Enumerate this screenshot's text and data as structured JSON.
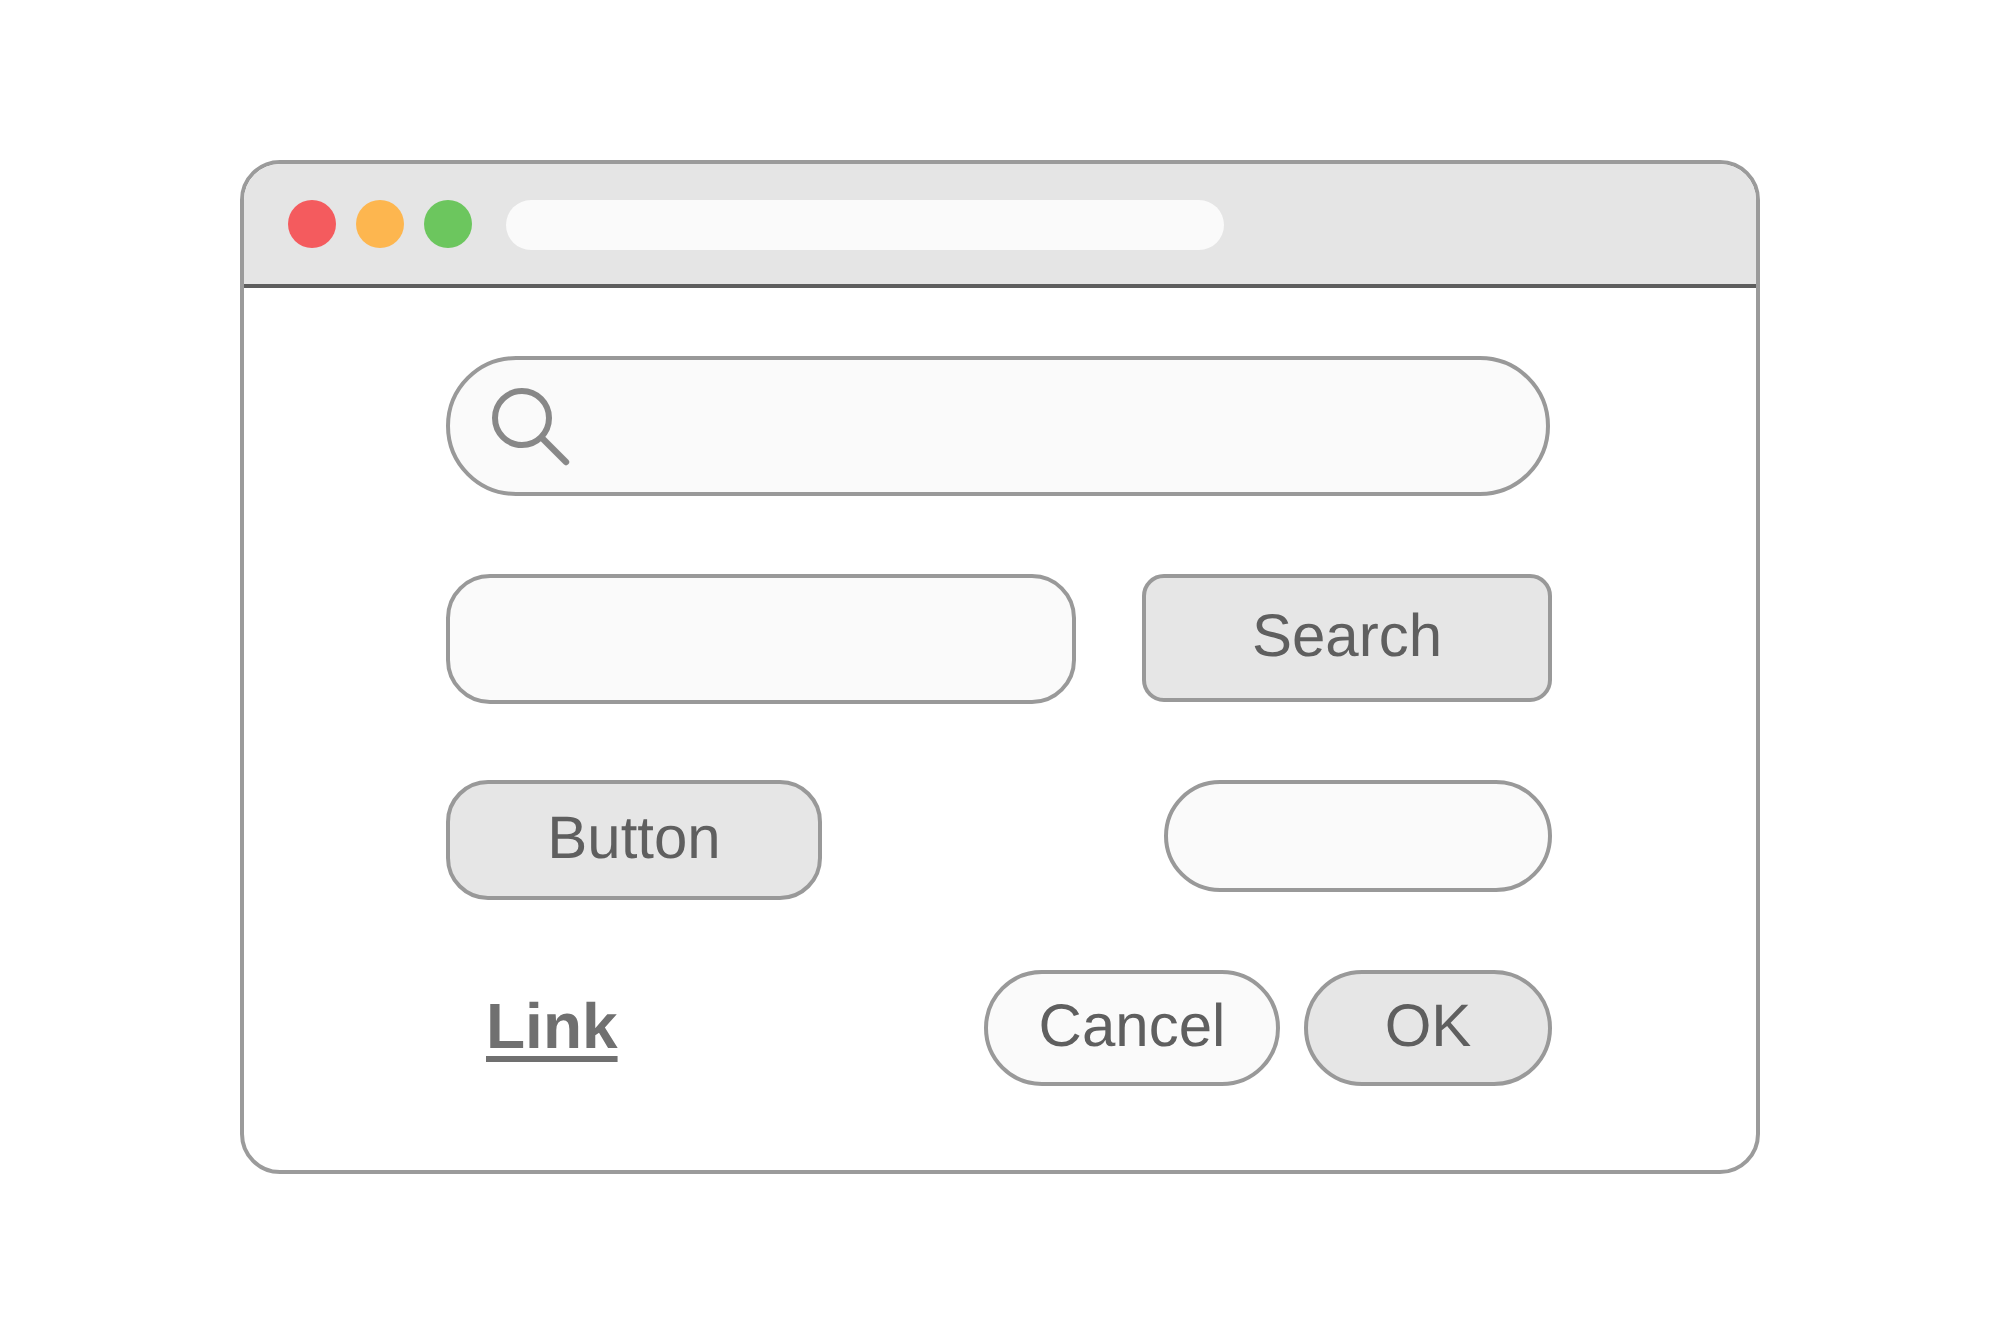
{
  "window": {
    "traffic_lights": [
      {
        "color": "#f45b5e"
      },
      {
        "color": "#fdb64f"
      },
      {
        "color": "#6cc65e"
      }
    ]
  },
  "rows": [
    [
      {
        "kind": "search-field"
      }
    ],
    [
      {
        "kind": "field"
      },
      {
        "kind": "button",
        "label": "Search"
      }
    ],
    [
      {
        "kind": "button",
        "label": "Button"
      },
      {
        "kind": "field"
      }
    ],
    [
      {
        "kind": "link",
        "label": "Link"
      },
      {
        "kind": "outline-button",
        "label": "Cancel"
      },
      {
        "kind": "button",
        "label": "OK"
      }
    ]
  ]
}
